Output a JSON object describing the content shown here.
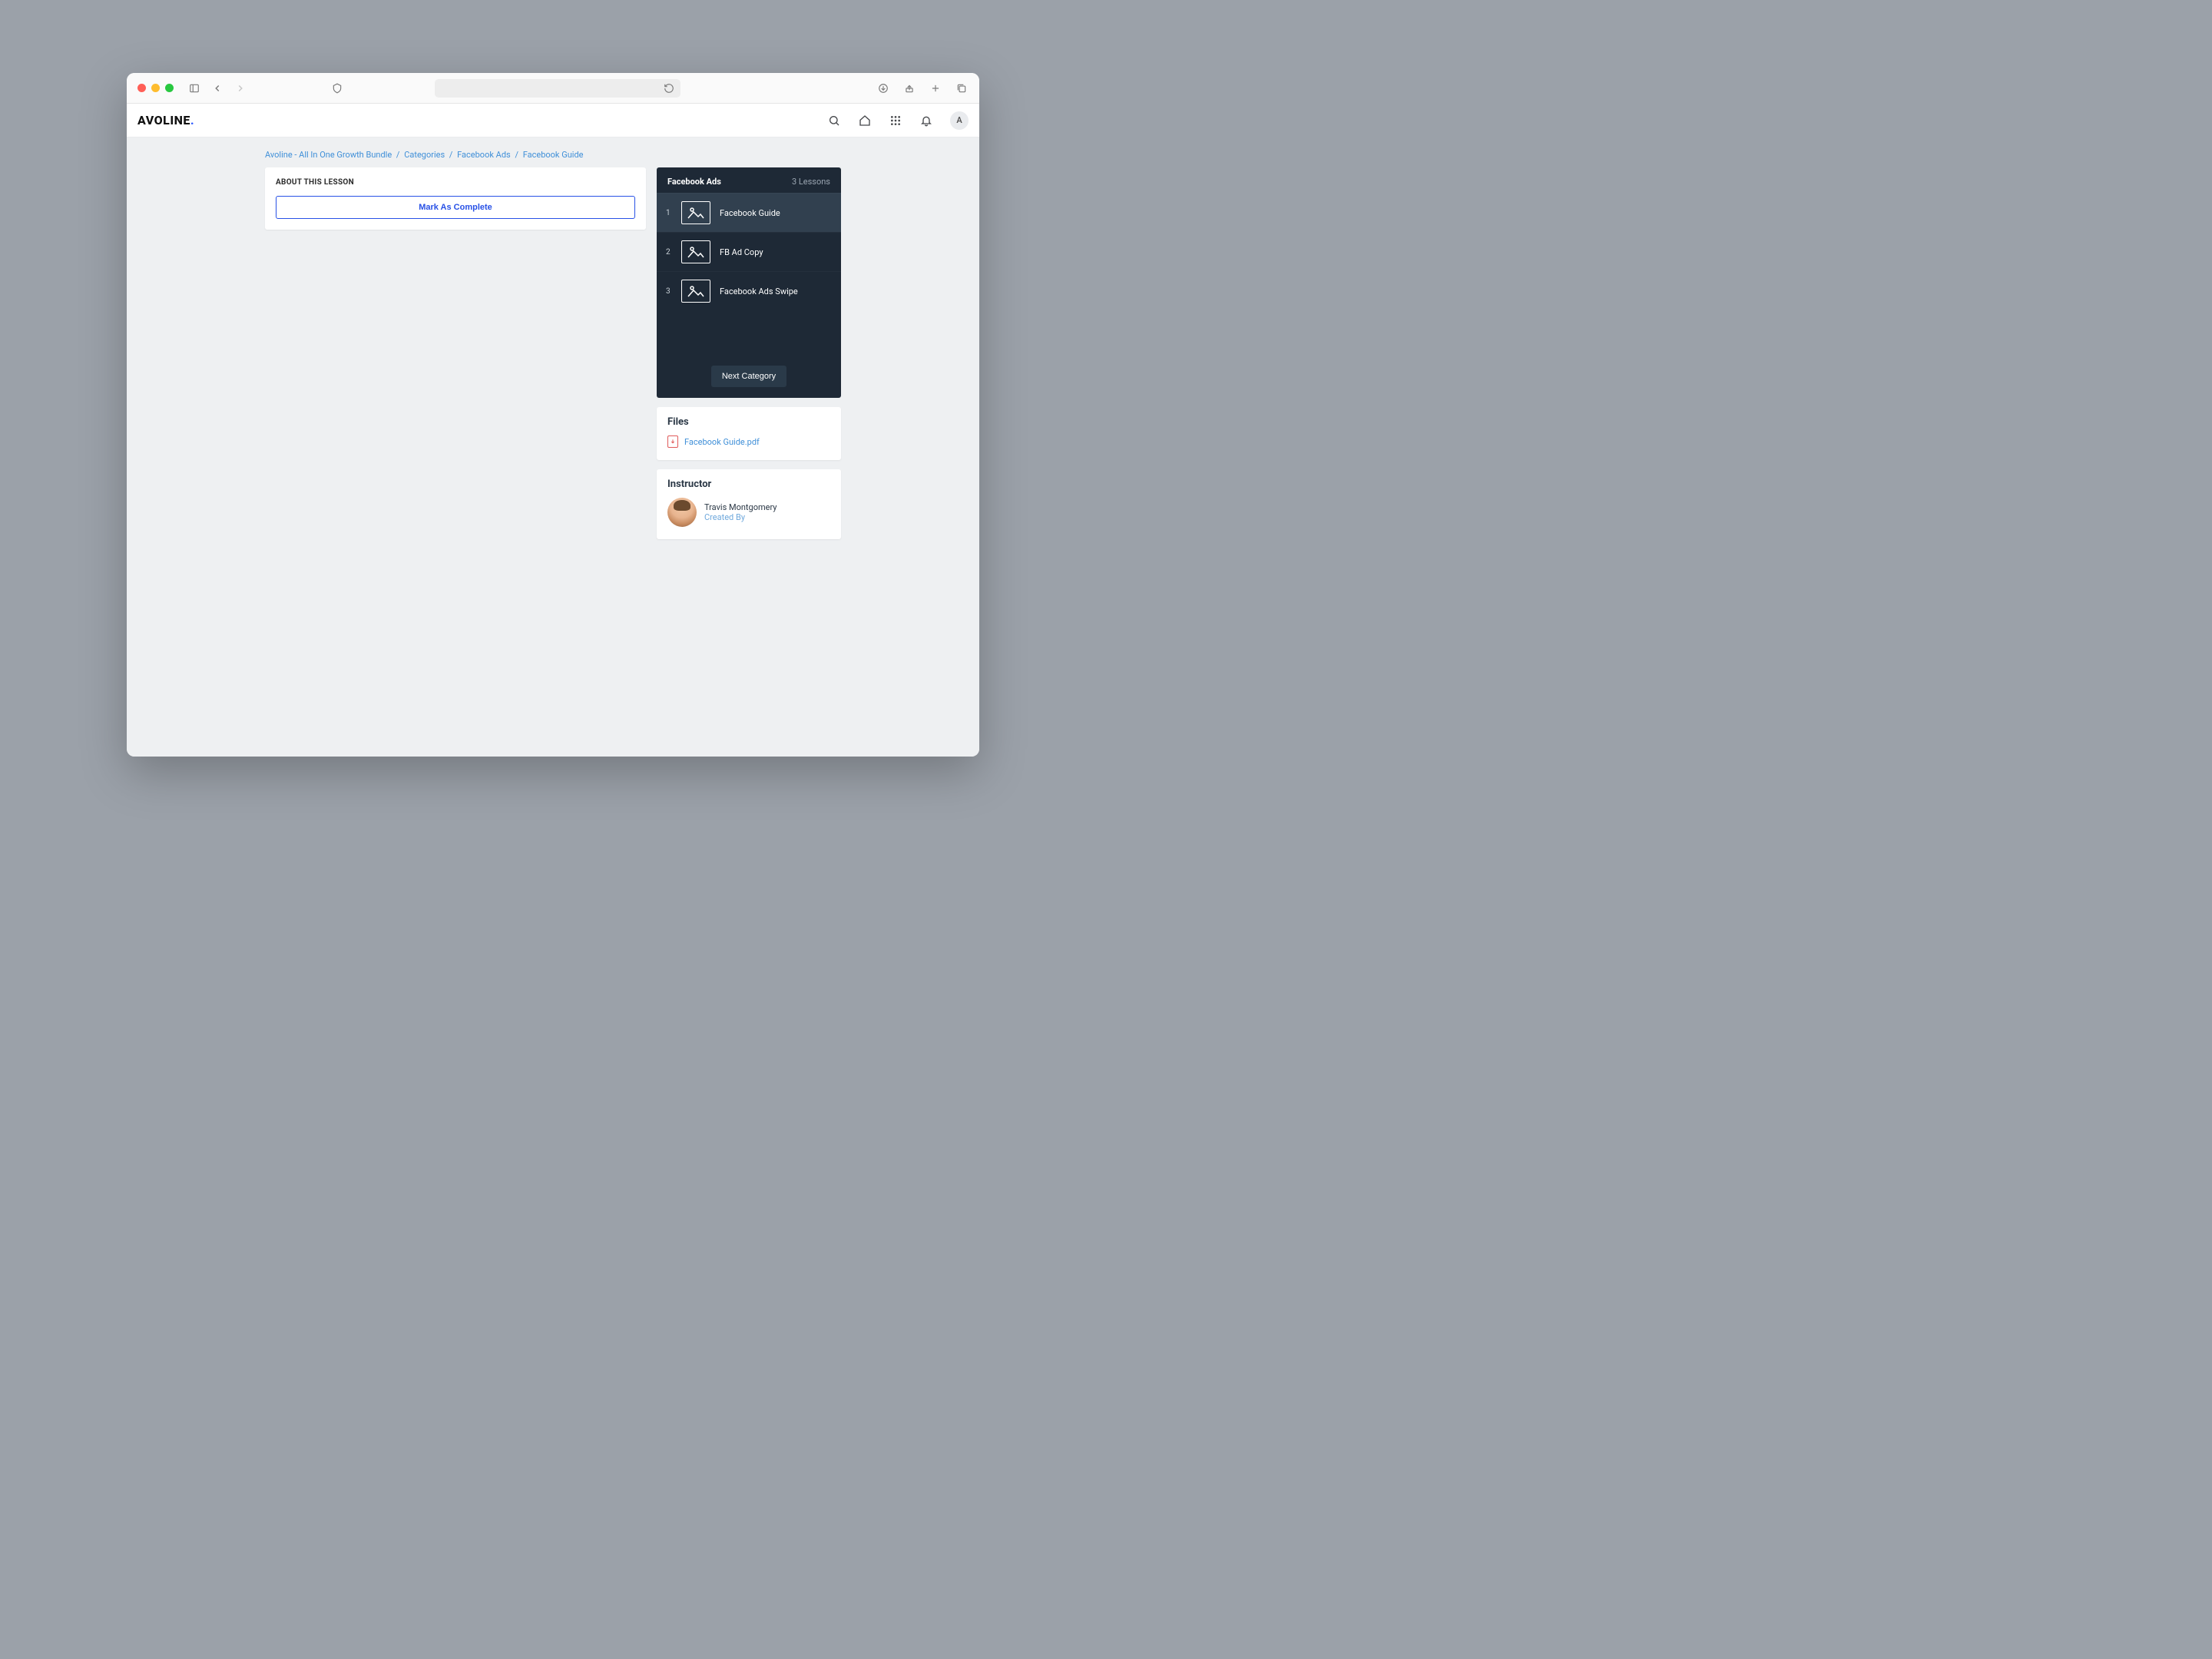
{
  "logo": {
    "text": "AVOLINE",
    "dot": "."
  },
  "avatar_initial": "A",
  "breadcrumb": {
    "items": [
      "Avoline - All In One Growth Bundle",
      "Categories",
      "Facebook Ads",
      "Facebook Guide"
    ]
  },
  "about": {
    "title": "ABOUT THIS LESSON",
    "mark_complete": "Mark As Complete"
  },
  "lessons": {
    "title": "Facebook Ads",
    "count": "3 Lessons",
    "items": [
      {
        "num": "1",
        "label": "Facebook Guide",
        "active": true
      },
      {
        "num": "2",
        "label": "FB Ad Copy",
        "active": false
      },
      {
        "num": "3",
        "label": "Facebook Ads Swipe",
        "active": false
      }
    ],
    "next_category": "Next Category"
  },
  "files": {
    "title": "Files",
    "items": [
      {
        "name": "Facebook Guide.pdf"
      }
    ]
  },
  "instructor": {
    "title": "Instructor",
    "name": "Travis Montgomery",
    "role": "Created By"
  }
}
